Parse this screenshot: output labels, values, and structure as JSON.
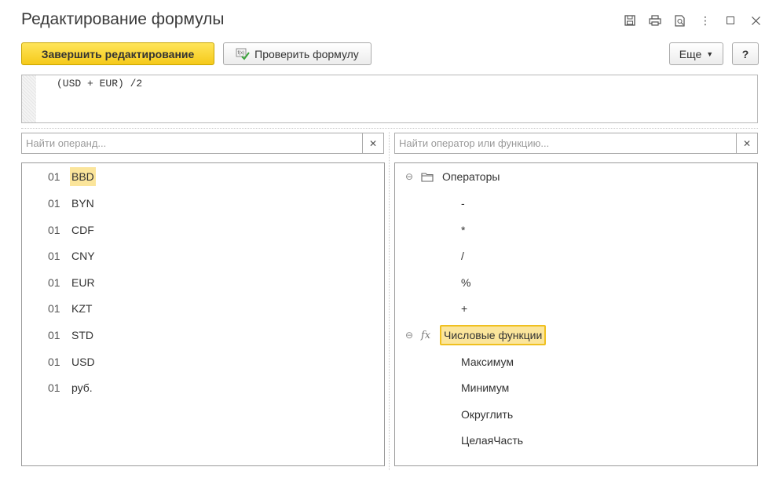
{
  "window": {
    "title": "Редактирование формулы"
  },
  "toolbar": {
    "finish_label": "Завершить редактирование",
    "check_label": "Проверить формулу",
    "more_label": "Еще",
    "help_label": "?"
  },
  "editor": {
    "formula": "(USD + EUR) /2"
  },
  "operands": {
    "search_placeholder": "Найти операнд...",
    "items": [
      {
        "num": "01",
        "name": "BBD",
        "selected": true
      },
      {
        "num": "01",
        "name": "BYN"
      },
      {
        "num": "01",
        "name": "CDF"
      },
      {
        "num": "01",
        "name": "CNY"
      },
      {
        "num": "01",
        "name": "EUR"
      },
      {
        "num": "01",
        "name": "KZT"
      },
      {
        "num": "01",
        "name": "STD"
      },
      {
        "num": "01",
        "name": "USD"
      },
      {
        "num": "01",
        "name": "руб."
      }
    ]
  },
  "functions": {
    "search_placeholder": "Найти оператор или функцию...",
    "groups": [
      {
        "label": "Операторы",
        "icon": "folder-icon",
        "items": [
          "-",
          "*",
          "/",
          "%",
          "+"
        ]
      },
      {
        "label": "Числовые функции",
        "icon": "fx-icon",
        "selected": true,
        "items": [
          "Максимум",
          "Минимум",
          "Округлить",
          "ЦелаяЧасть"
        ]
      }
    ]
  },
  "colors": {
    "primary_button": "#f5c91a",
    "selection": "#fbe59b"
  }
}
